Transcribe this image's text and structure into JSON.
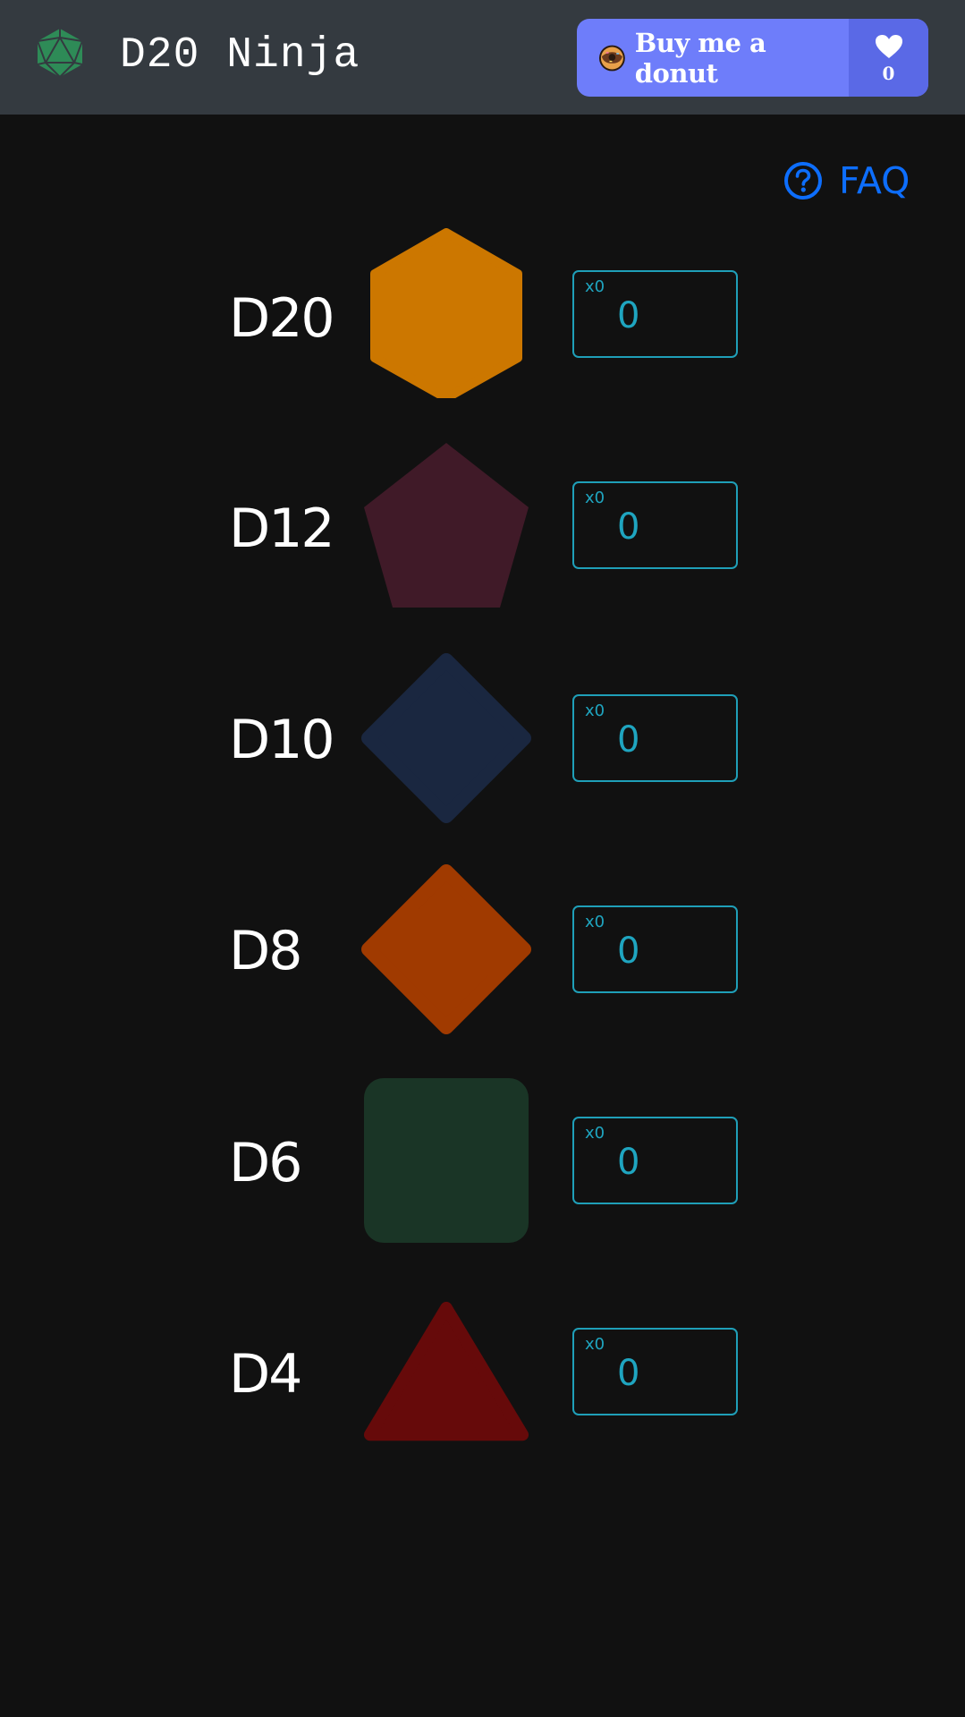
{
  "header": {
    "title": "D20 Ninja",
    "logo_color": "#2e8b57",
    "donut_button": {
      "label": "Buy me a donut",
      "count": "0",
      "background": "#6e7dfa"
    }
  },
  "faq": {
    "label": "FAQ",
    "color": "#0d6efd"
  },
  "dice": [
    {
      "label": "D20",
      "multiplier": "x0",
      "count": "0",
      "shape": "hexagon",
      "color": "#cc7700"
    },
    {
      "label": "D12",
      "multiplier": "x0",
      "count": "0",
      "shape": "pentagon",
      "color": "#401a28"
    },
    {
      "label": "D10",
      "multiplier": "x0",
      "count": "0",
      "shape": "diamond",
      "color": "#1a2740"
    },
    {
      "label": "D8",
      "multiplier": "x0",
      "count": "0",
      "shape": "diamond",
      "color": "#a03a00"
    },
    {
      "label": "D6",
      "multiplier": "x0",
      "count": "0",
      "shape": "square",
      "color": "#1a3526"
    },
    {
      "label": "D4",
      "multiplier": "x0",
      "count": "0",
      "shape": "triangle",
      "color": "#660a0a"
    }
  ]
}
